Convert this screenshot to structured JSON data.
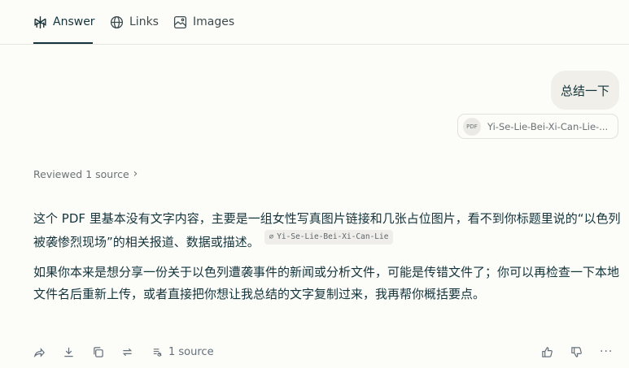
{
  "tabs": [
    {
      "label": "Answer",
      "icon": "perplexity-icon",
      "active": true
    },
    {
      "label": "Links",
      "icon": "globe-icon"
    },
    {
      "label": "Images",
      "icon": "image-icon"
    }
  ],
  "user_message": "总结一下",
  "attachment": {
    "badge": "PDF",
    "filename": "Yi-Se-Lie-Bei-Xi-Can-Lie-..."
  },
  "reviewed": {
    "label": "Reviewed 1 source",
    "chevron": "›"
  },
  "answer": {
    "p1_text": "这个 PDF 里基本没有文字内容，主要是一组女性写真图片链接和几张占位图片，看不到你标题里说的“以色列被袭惨烈现场”的相关报道、数据或描述。",
    "citation": "Yi-Se-Lie-Bei-Xi-Can-Lie",
    "p2_text": "如果你本来是想分享一份关于以色列遭袭事件的新闻或分析文件，可能是传错文件了；你可以再检查一下本地文件名后重新上传，或者直接把你想让我总结的文字复制过来，我再帮你概括要点。"
  },
  "actions": {
    "sources_label": "1 source",
    "more": "···"
  }
}
